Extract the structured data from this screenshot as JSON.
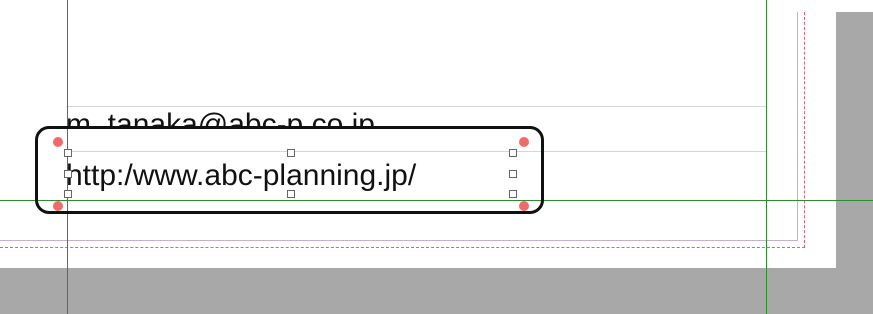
{
  "document": {
    "email_text": "m_tanaka@abc-p.co.jp",
    "url_text": "http:/www.abc-planning.jp/"
  },
  "colors": {
    "guide": "#2e8b2e",
    "bleed": "#e0607a",
    "pasteboard": "#a8a8a8",
    "corner_handle": "#f06a6a",
    "highlight_outline": "#111111"
  },
  "selection": {
    "object": "text-frame",
    "handles": [
      "selection-handle-icon"
    ],
    "corner_points": [
      "corner-point-icon"
    ]
  }
}
